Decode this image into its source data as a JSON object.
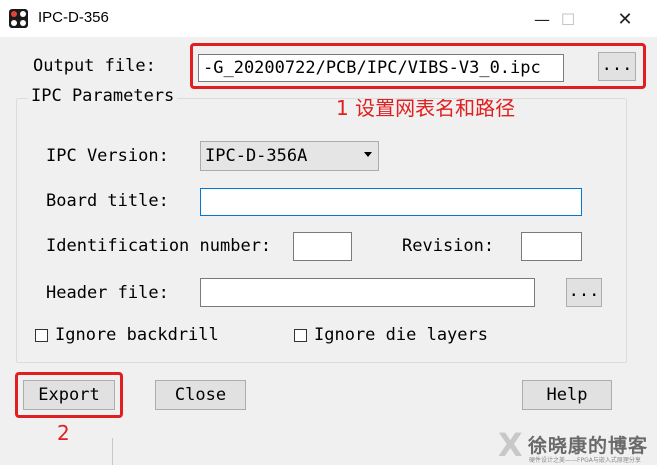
{
  "window": {
    "title": "IPC-D-356",
    "min_label": "—",
    "max_label": "☐",
    "close_label": "✕"
  },
  "output": {
    "label": "Output file:",
    "value": "-G_20200722/PCB/IPC/VIBS-V3_0.ipc",
    "browse_label": "..."
  },
  "params": {
    "group_title": "IPC Parameters",
    "version_label": "IPC Version:",
    "version_value": "IPC-D-356A",
    "board_title_label": "Board title:",
    "board_title_value": "",
    "identification_label": "Identification number:",
    "identification_value": "",
    "revision_label": "Revision:",
    "revision_value": "",
    "header_file_label": "Header file:",
    "header_file_value": "",
    "header_browse_label": "..."
  },
  "options": {
    "ignore_backdrill_label": "Ignore backdrill",
    "ignore_backdrill_checked": false,
    "ignore_die_layers_label": "Ignore die layers",
    "ignore_die_layers_checked": false
  },
  "actions": {
    "export_label": "Export",
    "close_label": "Close",
    "help_label": "Help"
  },
  "annotations": {
    "step1": "1 设置网表名和路径",
    "step2": "2",
    "color": "#e02020"
  },
  "watermark": {
    "mark": "X",
    "name": "徐晓康的博客",
    "sub": "硬件设计之美——FPGA与嵌入式原理分享"
  }
}
